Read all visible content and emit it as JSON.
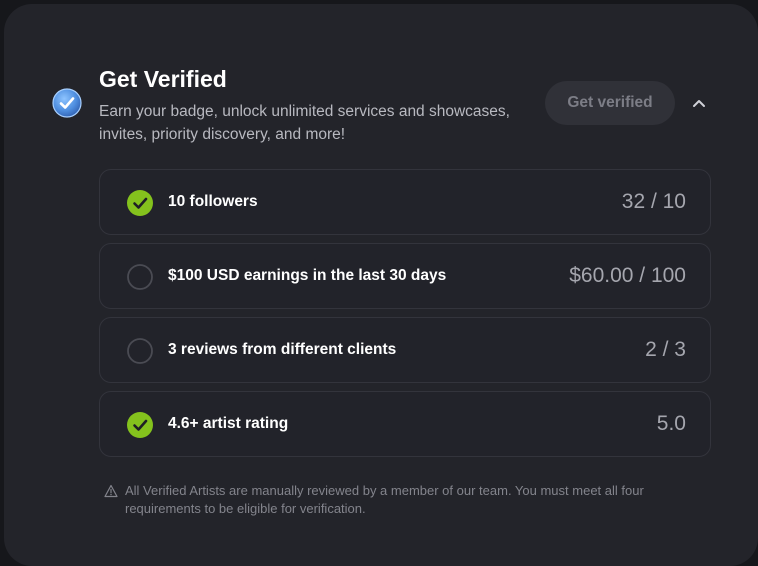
{
  "header": {
    "title": "Get Verified",
    "subtitle": "Earn your badge, unlock unlimited services and showcases, invites, priority discovery, and more!",
    "button_label": "Get verified"
  },
  "requirements": [
    {
      "label": "10 followers",
      "progress": "32 / 10",
      "met": true
    },
    {
      "label": "$100 USD earnings in the last 30 days",
      "progress": "$60.00 / 100",
      "met": false
    },
    {
      "label": "3 reviews from different clients",
      "progress": "2 / 3",
      "met": false
    },
    {
      "label": "4.6+ artist rating",
      "progress": "5.0",
      "met": true
    }
  ],
  "note": "All Verified Artists are manually reviewed by a member of our team. You must meet all four requirements to be eligible for verification.",
  "icons": {
    "badge": "verified-badge-icon",
    "met": "check-circle-icon",
    "unmet": "empty-circle-icon",
    "collapse": "chevron-up-icon",
    "note": "warning-triangle-icon"
  },
  "colors": {
    "card_background": "#23242a",
    "check_green": "#84c21d",
    "badge_blue": "#4f8fe0",
    "button_background": "#303138",
    "button_text": "#7c7d86"
  }
}
